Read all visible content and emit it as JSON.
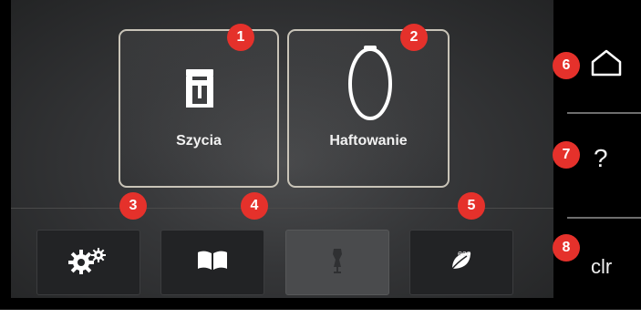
{
  "tiles": {
    "sewing_label": "Szycia",
    "embroidery_label": "Haftowanie"
  },
  "toolbar": {
    "settings_icon": "gears-icon",
    "tutorial_icon": "book-icon",
    "dressform_icon": "dress-form-icon",
    "eco_label": "eco"
  },
  "sidebar": {
    "home_icon": "home-icon",
    "help_label": "?",
    "clear_label": "clr"
  },
  "badges": [
    "1",
    "2",
    "3",
    "4",
    "5",
    "6",
    "7",
    "8"
  ],
  "colors": {
    "badge": "#e5312b",
    "tile_border": "#c9c4b8",
    "background": "#000000"
  }
}
